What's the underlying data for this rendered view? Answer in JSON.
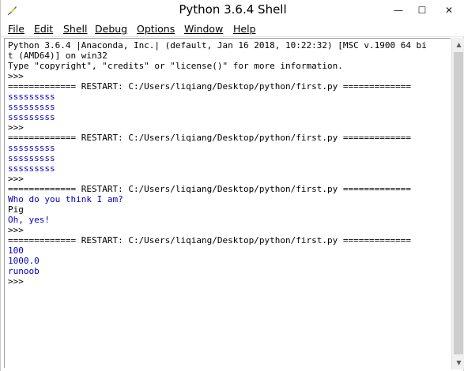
{
  "window": {
    "title": "Python 3.6.4 Shell",
    "icon": "python-feather-icon",
    "controls": {
      "minimize": "—",
      "maximize": "☐",
      "close": "✕"
    }
  },
  "menu": [
    {
      "label": "File"
    },
    {
      "label": "Edit"
    },
    {
      "label": "Shell"
    },
    {
      "label": "Debug"
    },
    {
      "label": "Options"
    },
    {
      "label": "Window"
    },
    {
      "label": "Help"
    }
  ],
  "shell": {
    "lines": [
      {
        "text": "Python 3.6.4 |Anaconda, Inc.| (default, Jan 16 2018, 10:22:32) [MSC v.1900 64 bi",
        "color": "black"
      },
      {
        "text": "t (AMD64)] on win32",
        "color": "black"
      },
      {
        "text": "Type \"copyright\", \"credits\" or \"license()\" for more information.",
        "color": "black"
      },
      {
        "text": ">>>",
        "color": "black"
      },
      {
        "text": "============= RESTART: C:/Users/liqiang/Desktop/python/first.py =============",
        "color": "black"
      },
      {
        "text": "sssssssss",
        "color": "blue"
      },
      {
        "text": "sssssssss",
        "color": "blue"
      },
      {
        "text": "sssssssss",
        "color": "blue"
      },
      {
        "text": ">>>",
        "color": "black"
      },
      {
        "text": "============= RESTART: C:/Users/liqiang/Desktop/python/first.py =============",
        "color": "black"
      },
      {
        "text": "sssssssss",
        "color": "blue"
      },
      {
        "text": "sssssssss",
        "color": "blue"
      },
      {
        "text": "sssssssss",
        "color": "blue"
      },
      {
        "text": ">>>",
        "color": "black"
      },
      {
        "text": "============= RESTART: C:/Users/liqiang/Desktop/python/first.py =============",
        "color": "black"
      },
      {
        "text": "Who do you think I am?",
        "color": "blue"
      },
      {
        "text": "Pig",
        "color": "black"
      },
      {
        "text": "Oh, yes!",
        "color": "blue"
      },
      {
        "text": ">>>",
        "color": "black"
      },
      {
        "text": "============= RESTART: C:/Users/liqiang/Desktop/python/first.py =============",
        "color": "black"
      },
      {
        "text": "100",
        "color": "blue"
      },
      {
        "text": "1000.0",
        "color": "blue"
      },
      {
        "text": "runoob",
        "color": "blue"
      },
      {
        "text": ">>>",
        "color": "black"
      }
    ]
  },
  "colors": {
    "stdout": "#0000c0",
    "text": "#000000",
    "background": "#ffffff"
  }
}
